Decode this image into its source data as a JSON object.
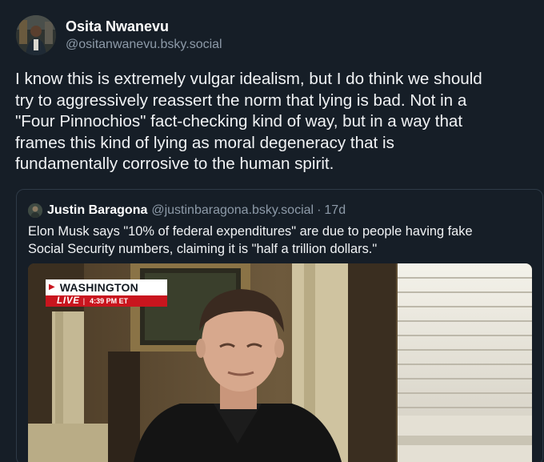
{
  "post": {
    "display_name": "Osita Nwanevu",
    "handle": "@ositanwanevu.bsky.social",
    "text": "I know this is extremely vulgar idealism, but I do think we should\ntry to aggressively reassert the norm that lying is bad. Not in a\n\"Four Pinnochios\" fact-checking kind of way, but in a way that\nframes this kind of lying as moral degeneracy that is\nfundamentally corrosive to the human spirit."
  },
  "quote": {
    "display_name": "Justin Baragona",
    "handle": "@justinbaragona.bsky.social",
    "separator": "·",
    "time": "17d",
    "text": "Elon Musk says \"10% of federal expenditures\" are due to people having fake\nSocial Security numbers, claiming it is \"half a trillion dollars.\"",
    "media": {
      "chyron_location": "WASHINGTON",
      "chyron_live": "LIVE",
      "chyron_bar": "|",
      "chyron_time": "4:39 PM ET"
    }
  },
  "colors": {
    "background": "#161e27",
    "text": "#f1f3f5",
    "muted": "#8d9aa8",
    "border": "#2e3a47",
    "chyron_red": "#c9151e"
  }
}
